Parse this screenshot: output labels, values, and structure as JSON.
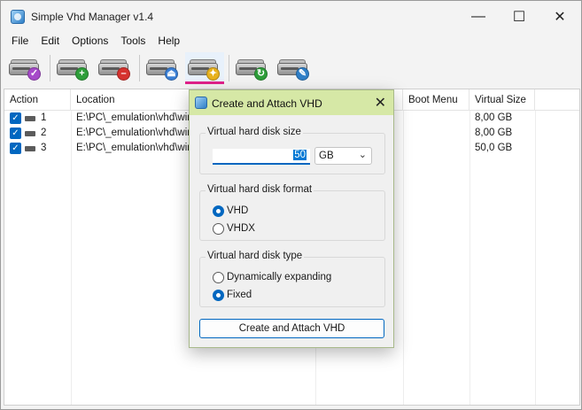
{
  "window": {
    "title": "Simple Vhd Manager v1.4",
    "minimize_icon": "minimize-icon",
    "maximize_icon": "maximize-icon",
    "close_icon": "close-icon"
  },
  "menu": [
    "File",
    "Edit",
    "Options",
    "Tools",
    "Help"
  ],
  "toolbar": [
    {
      "name": "attach-vhd-button",
      "icon": "drive-check-icon",
      "badge": "✓",
      "badge_color": "#a64ac9"
    },
    {
      "name": "add-vhd-button",
      "icon": "drive-add-icon",
      "badge": "+",
      "badge_color": "#2e9e3a"
    },
    {
      "name": "remove-vhd-button",
      "icon": "drive-remove-icon",
      "badge": "–",
      "badge_color": "#d6322e"
    },
    {
      "name": "detach-vhd-button",
      "icon": "drive-eject-icon",
      "badge": "⏏",
      "badge_color": "#3a7fd5"
    },
    {
      "name": "create-vhd-button",
      "icon": "drive-gear-icon",
      "badge": "✦",
      "badge_color": "#e8b21e",
      "active": true
    },
    {
      "name": "refresh-vhd-button",
      "icon": "drive-refresh-icon",
      "badge": "↻",
      "badge_color": "#2e9e3a"
    },
    {
      "name": "settings-vhd-button",
      "icon": "drive-wrench-icon",
      "badge": "✎",
      "badge_color": "#2f7fc7"
    }
  ],
  "accent": "#e0218a",
  "list": {
    "columns": [
      "Action",
      "Location",
      "Boot Menu",
      "Virtual Size"
    ],
    "rows": [
      {
        "num": "1",
        "location": "E:\\PC\\_emulation\\vhd\\win9",
        "boot": "",
        "size": "8,00 GB",
        "checked": true
      },
      {
        "num": "2",
        "location": "E:\\PC\\_emulation\\vhd\\win9",
        "boot": "",
        "size": "8,00 GB",
        "checked": true
      },
      {
        "num": "3",
        "location": "E:\\PC\\_emulation\\vhd\\win9",
        "boot": "",
        "size": "50,0 GB",
        "checked": true
      }
    ]
  },
  "dialog": {
    "title": "Create and Attach VHD",
    "size_group": "Virtual hard disk size",
    "size_value": "50",
    "size_unit": "GB",
    "format_group": "Virtual hard disk format",
    "format_options": [
      {
        "label": "VHD",
        "checked": true
      },
      {
        "label": "VHDX",
        "checked": false
      }
    ],
    "type_group": "Virtual hard disk type",
    "type_options": [
      {
        "label": "Dynamically expanding",
        "checked": false
      },
      {
        "label": "Fixed",
        "checked": true
      }
    ],
    "create_button": "Create and Attach VHD"
  }
}
